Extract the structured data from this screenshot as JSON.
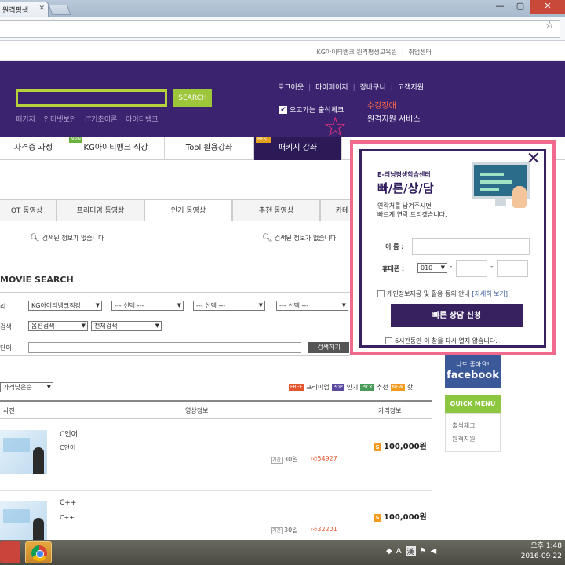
{
  "browser": {
    "tab_title": "원격평생",
    "tab_close": "✕",
    "window_controls": [
      "—",
      "▢",
      "✕"
    ],
    "star": "☆"
  },
  "util_bar": {
    "links": [
      "KG아이티뱅크 원격평생교육원",
      "취업센터"
    ]
  },
  "header": {
    "search_button": "SEARCH",
    "quick_keywords": [
      "패키지",
      "인터넷보안",
      "IT기초이론",
      "아이티뱅크"
    ],
    "member_links": [
      "로그이웃",
      "마이페이지",
      "장바구니",
      "고객지원"
    ],
    "attendance_label": "출석체크",
    "attendance_prefix": "오고가는",
    "remote_line1": "수강장애",
    "remote_line2": "원격지원 서비스"
  },
  "main_nav": {
    "items": [
      "자격증 과정",
      "KG아이티뱅크 직강",
      "Tool 활용강좌",
      "패키지 강좌"
    ],
    "badge_new": "New",
    "badge_best": "BEST"
  },
  "content_tabs": {
    "items": [
      "OT 동영상",
      "프리미엄 동영상",
      "인기 동영상",
      "추천 동영상",
      "카테"
    ]
  },
  "no_result": [
    "검색된 정보가 없습니다",
    "검색된 정보가 없습니다"
  ],
  "movie_search": {
    "title": "MOVIE SEARCH",
    "row_labels": [
      "리",
      "검색",
      "단어"
    ],
    "selects_row1": [
      "KG아이티뱅크직강",
      "--- 선택 ---",
      "--- 선택 ---",
      "--- 선택 ---"
    ],
    "selects_row2": [
      "옵션검색",
      "전체검색"
    ],
    "search_button": "검색하기",
    "sort": "가격낮은순",
    "legend": [
      {
        "tag": "FREE",
        "label": "프리미엄",
        "color": "#e4572e"
      },
      {
        "tag": "POP",
        "label": "인기",
        "color": "#5b4aa0"
      },
      {
        "tag": "PICK",
        "label": "추천",
        "color": "#4a9a5a"
      },
      {
        "tag": "NEW",
        "label": "핫",
        "color": "#f39a1f"
      }
    ]
  },
  "result_table": {
    "headers": [
      "사진",
      "영상정보",
      "가격정보"
    ],
    "rows": [
      {
        "title": "C언어",
        "subtitle": "C언어",
        "period_tag": "기간",
        "period": "30일",
        "likes": "54927",
        "price": "100,000원"
      },
      {
        "title": "C++",
        "subtitle": "C++",
        "period_tag": "기간",
        "period": "30일",
        "likes": "32201",
        "price": "100,000원"
      }
    ]
  },
  "side_widgets": {
    "fb_line0": "나도 좋아",
    "fb_line1": "나도 좋아요!",
    "fb_line2": "facebook",
    "quick_menu_title": "QUICK MENU",
    "quick_menu_items": [
      "출석체크",
      "원격지원"
    ]
  },
  "popup": {
    "small_title": "E-러닝평생학습센터",
    "big_title": "빠/른/상/담",
    "desc_line1": "연락처를 남겨주시면",
    "desc_line2": "빠르게 연락 드리겠습니다.",
    "name_label": "이   름 :",
    "phone_label": "휴대폰 :",
    "phone_prefix": "010",
    "consent_text": "개인정보제공 및 활용 동의 안내",
    "consent_link": "[자세히 보기]",
    "submit_button": "빠른 상담 신청",
    "dismiss_text": "6시간동안 이 창을 다시 열지 않습니다."
  },
  "taskbar": {
    "tray_a": "A",
    "tray_ime": "漢",
    "time": "오후 1:48",
    "date": "2016-09-22"
  },
  "colors": {
    "header_purple": "#3b2370",
    "accent_green": "#9ec63a",
    "popup_border_pink": "#ef6a8c",
    "popup_purple": "#37225f",
    "facebook_blue": "#3b5998"
  }
}
